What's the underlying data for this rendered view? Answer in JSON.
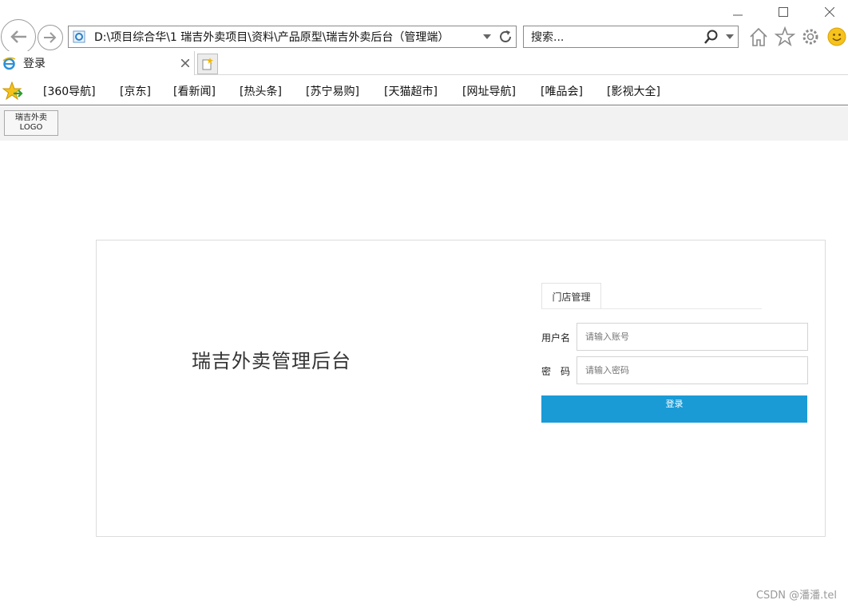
{
  "browser": {
    "address": "D:\\项目综合华\\1 瑞吉外卖项目\\资料\\产品原型\\瑞吉外卖后台（管理端）",
    "search_placeholder": "搜索...",
    "tab_title": "登录",
    "favorites": [
      "[360导航]",
      "[京东]",
      "[看新闻]",
      "[热头条]",
      "[苏宁易购]",
      "[天猫超市]",
      "[网址导航]",
      "[唯品会]",
      "[影视大全]"
    ],
    "icons": [
      "back-icon",
      "forward-icon",
      "ie-icon",
      "dropdown-icon",
      "refresh-icon",
      "search-icon",
      "home-icon",
      "favorites-star-icon",
      "settings-gear-icon",
      "smiley-feedback-icon",
      "close-tab-icon",
      "new-tab-icon",
      "favorites-add-icon"
    ]
  },
  "page": {
    "logo_line1": "瑞吉外卖",
    "logo_line2": "LOGO",
    "title": "瑞吉外卖管理后台",
    "tab_label": "门店管理",
    "username_label": "用户名",
    "username_placeholder": "请输入账号",
    "password_label": "密　码",
    "password_placeholder": "请输入密码",
    "login_button": "登录"
  },
  "watermark": "CSDN @潘潘.tel",
  "colors": {
    "accent": "#1a9bd6",
    "header_bg": "#f2f2f2"
  }
}
